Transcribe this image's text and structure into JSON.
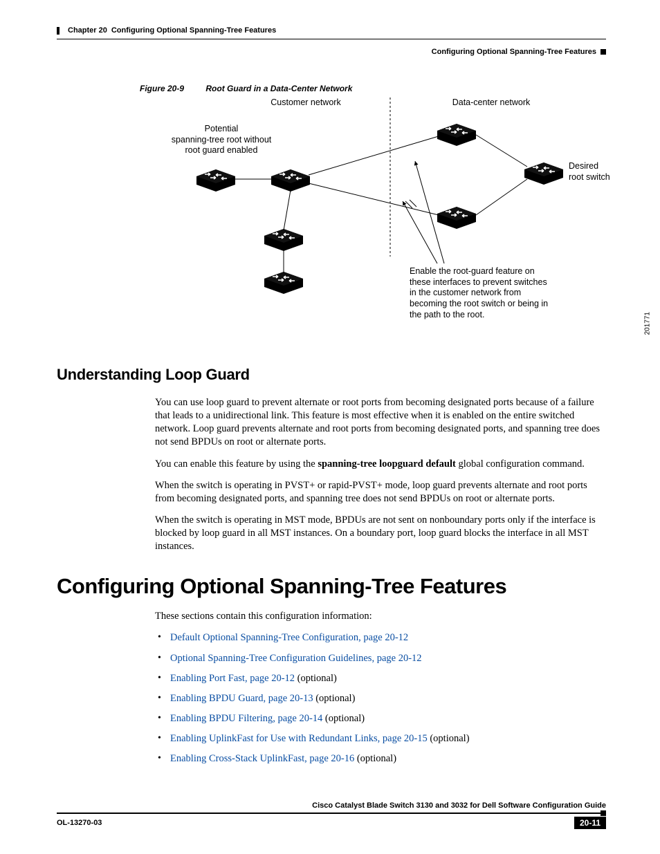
{
  "header": {
    "chapter_label": "Chapter 20",
    "chapter_title": "Configuring Optional Spanning-Tree Features",
    "running_head": "Configuring Optional Spanning-Tree Features"
  },
  "figure": {
    "number": "Figure 20-9",
    "title": "Root Guard in a Data-Center Network",
    "label_customer": "Customer network",
    "label_datacenter": "Data-center network",
    "label_potential": "Potential\nspanning-tree root without\nroot guard enabled",
    "label_desired": "Desired\nroot switch",
    "label_enable": "Enable the root-guard feature on these interfaces to prevent switches in the customer network from becoming the root switch or being in the path to the root.",
    "fig_id": "201771"
  },
  "section1": {
    "title": "Understanding Loop Guard",
    "p1": "You can use loop guard to prevent alternate or root ports from becoming designated ports because of a failure that leads to a unidirectional link. This feature is most effective when it is enabled on the entire switched network. Loop guard prevents alternate and root ports from becoming designated ports, and spanning tree does not send BPDUs on root or alternate ports.",
    "p2a": "You can enable this feature by using the ",
    "p2_cmd": "spanning-tree loopguard default",
    "p2b": " global configuration command.",
    "p3": "When the switch is operating in PVST+ or rapid-PVST+ mode, loop guard prevents alternate and root ports from becoming designated ports, and spanning tree does not send BPDUs on root or alternate ports.",
    "p4": "When the switch is operating in MST mode, BPDUs are not sent on nonboundary ports only if the interface is blocked by loop guard in all MST instances. On a boundary port, loop guard blocks the interface in all MST instances."
  },
  "section2": {
    "title": "Configuring Optional Spanning-Tree Features",
    "intro": "These sections contain this configuration information:",
    "items": [
      {
        "link": "Default Optional Spanning-Tree Configuration, page 20-12",
        "suffix": ""
      },
      {
        "link": "Optional Spanning-Tree Configuration Guidelines, page 20-12",
        "suffix": ""
      },
      {
        "link": "Enabling Port Fast, page 20-12",
        "suffix": " (optional)"
      },
      {
        "link": "Enabling BPDU Guard, page 20-13",
        "suffix": " (optional)"
      },
      {
        "link": "Enabling BPDU Filtering, page 20-14",
        "suffix": " (optional)"
      },
      {
        "link": "Enabling UplinkFast for Use with Redundant Links, page 20-15",
        "suffix": " (optional)"
      },
      {
        "link": "Enabling Cross-Stack UplinkFast, page 20-16",
        "suffix": " (optional)"
      }
    ]
  },
  "footer": {
    "guide_title": "Cisco Catalyst Blade Switch 3130 and 3032 for Dell Software Configuration Guide",
    "doc_id": "OL-13270-03",
    "page": "20-11"
  }
}
